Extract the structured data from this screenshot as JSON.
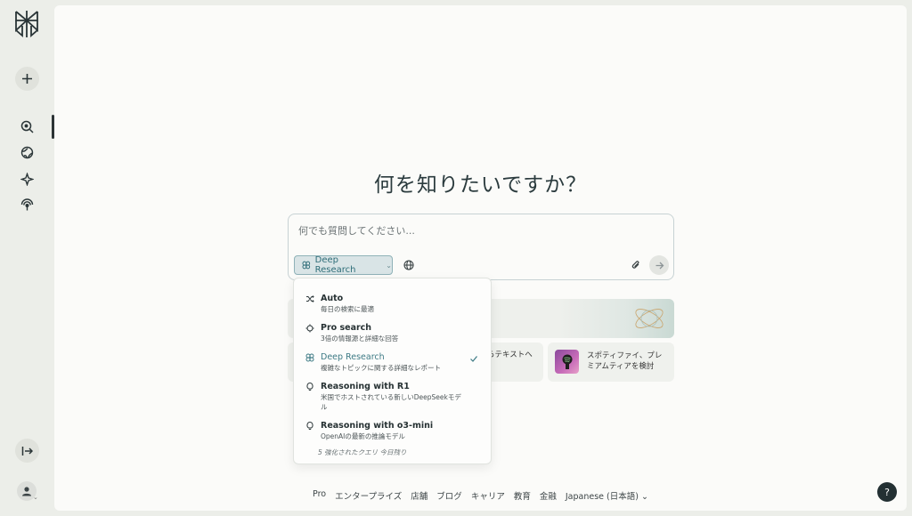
{
  "heading": "何を知りたいですか？",
  "search": {
    "placeholder": "何でも質問してください..."
  },
  "mode_button": {
    "label": "Deep Research"
  },
  "dropdown": {
    "items": [
      {
        "title": "Auto",
        "desc": "毎日の検索に最適",
        "icon": "shuffle-icon"
      },
      {
        "title": "Pro search",
        "desc": "3倍の情報源と詳細な回答",
        "icon": "pro-search-icon"
      },
      {
        "title": "Deep Research",
        "desc": "複雑なトピックに関する詳細なレポート",
        "icon": "deep-research-icon",
        "selected": true
      },
      {
        "title": "Reasoning with R1",
        "desc": "米国でホストされている新しいDeepSeekモデル",
        "icon": "bulb-icon"
      },
      {
        "title": "Reasoning with o3-mini",
        "desc": "OpenAIの最新の推論モデル",
        "icon": "bulb-icon"
      }
    ],
    "footer": "5 強化されたクエリ 今日残り"
  },
  "cards": {
    "card2_text": "らテキストへ",
    "card3_text": "スポティファイ、プレミアムティアを検討"
  },
  "footer": {
    "links": [
      "Pro",
      "エンタープライズ",
      "店舗",
      "ブログ",
      "キャリア",
      "教育",
      "金融"
    ],
    "language": "Japanese (日本語)"
  },
  "help_label": "?",
  "colors": {
    "accent": "#2e6d78",
    "background": "#eceee9",
    "panel": "#fbfbf9"
  }
}
